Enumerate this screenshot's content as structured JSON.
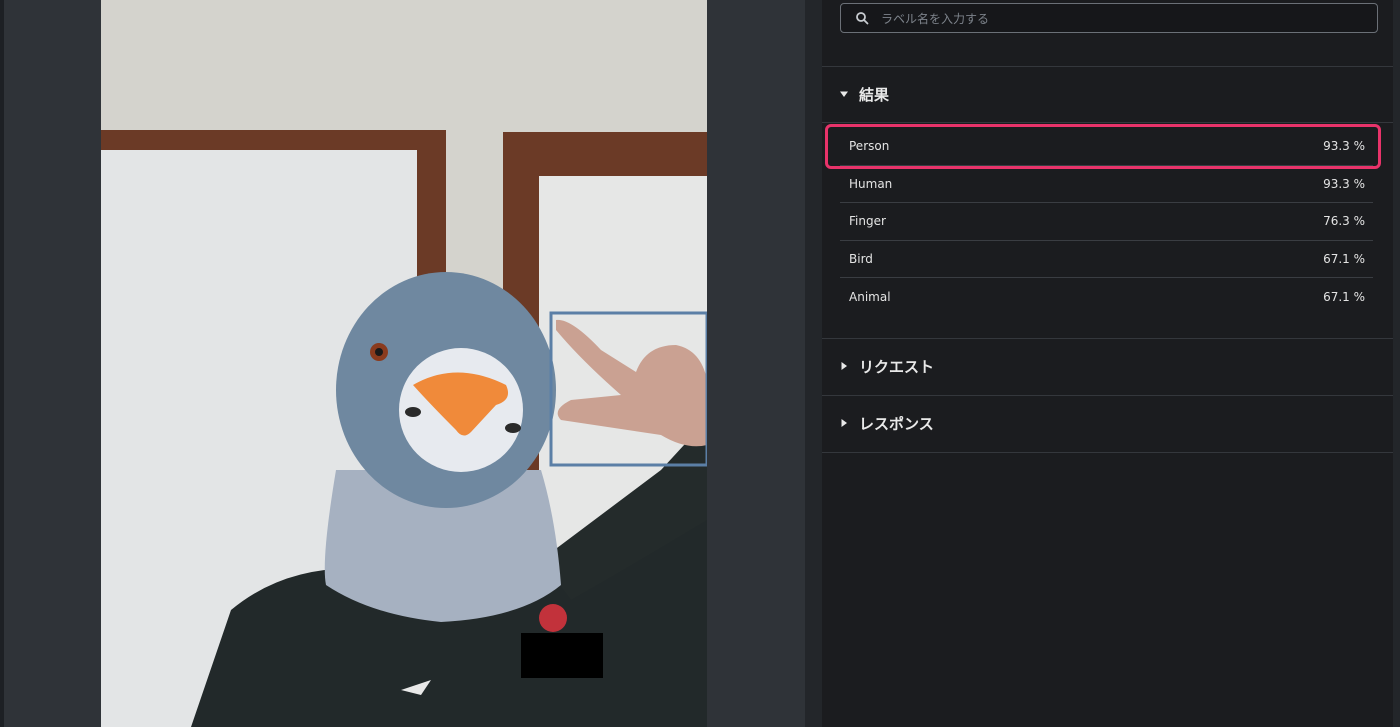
{
  "search": {
    "placeholder": "ラベル名を入力する",
    "icon": "search-icon"
  },
  "sections": {
    "results": {
      "title": "結果",
      "expanded": true
    },
    "request": {
      "title": "リクエスト",
      "expanded": false
    },
    "response": {
      "title": "レスポンス",
      "expanded": false
    }
  },
  "results": [
    {
      "label": "Person",
      "confidence": "93.3 %"
    },
    {
      "label": "Human",
      "confidence": "93.3 %"
    },
    {
      "label": "Finger",
      "confidence": "76.3 %"
    },
    {
      "label": "Bird",
      "confidence": "67.1 %"
    },
    {
      "label": "Animal",
      "confidence": "67.1 %"
    }
  ],
  "colors": {
    "highlight": "#e8336a",
    "bounding_box": "#5b7fa6",
    "panel_bg": "#1b1c1f"
  }
}
